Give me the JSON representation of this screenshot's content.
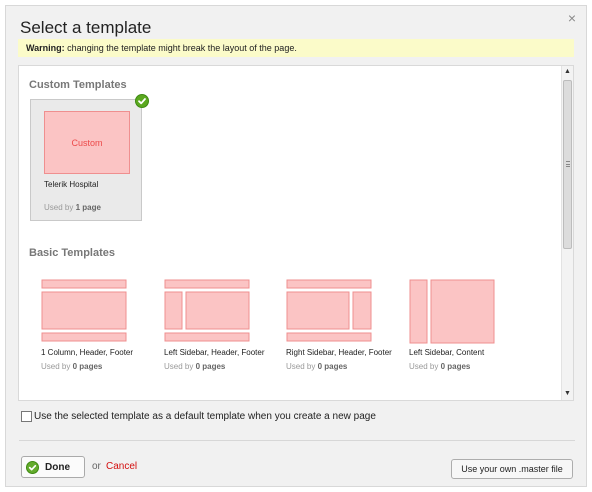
{
  "dialog": {
    "title": "Select a template",
    "close_icon": "×"
  },
  "warning": {
    "label": "Warning:",
    "text": " changing the template might break the layout of the page."
  },
  "custom": {
    "title": "Custom Templates",
    "card": {
      "thumb_label": "Custom",
      "name": "Telerik Hospital",
      "usage_prefix": "Used by ",
      "usage_count": "1 page",
      "selected": true
    }
  },
  "basic": {
    "title": "Basic Templates",
    "templates": [
      {
        "name": "1 Column, Header, Footer",
        "usage_prefix": "Used by ",
        "usage_count": "0 pages",
        "layout": "header-body-footer"
      },
      {
        "name": "Left Sidebar, Header, Footer",
        "usage_prefix": "Used by ",
        "usage_count": "0 pages",
        "layout": "header-leftsidebar-footer"
      },
      {
        "name": "Right Sidebar, Header, Footer",
        "usage_prefix": "Used by ",
        "usage_count": "0 pages",
        "layout": "header-rightsidebar-footer"
      },
      {
        "name": "Left Sidebar, Content",
        "usage_prefix": "Used by ",
        "usage_count": "0 pages",
        "layout": "leftsidebar-content"
      }
    ]
  },
  "default_option": {
    "label": "Use the selected template as a default template when you create a new page",
    "checked": false
  },
  "footer": {
    "done_label": "Done",
    "or_text": "or",
    "cancel_label": "Cancel",
    "master_label": "Use your own .master file"
  },
  "colors": {
    "thumb_fill": "#fbc4c4",
    "thumb_border": "#ef8f8f",
    "accent_green": "#5ba81f",
    "cancel_red": "#d40f0f",
    "warning_bg": "#fbfbc9"
  },
  "icons": {
    "close": "close-icon",
    "selected_check": "check-circle-icon",
    "done": "check-circle-icon",
    "scroll_up": "arrow-up-icon",
    "scroll_down": "arrow-down-icon"
  }
}
